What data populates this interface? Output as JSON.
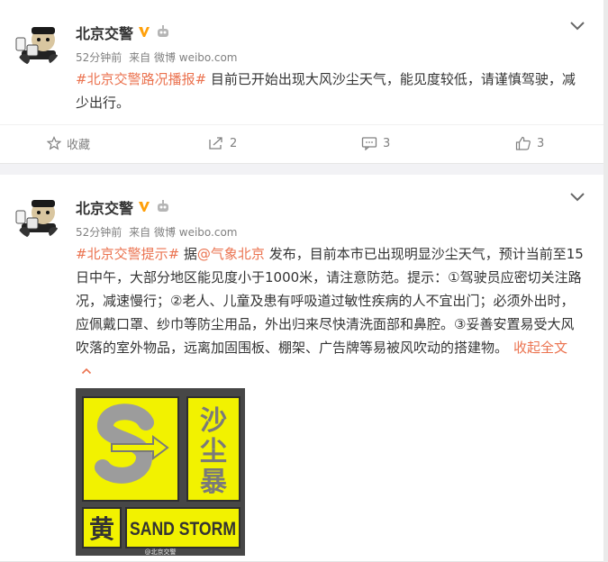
{
  "posts": [
    {
      "username": "北京交警",
      "time": "52分钟前",
      "from_label": "来自",
      "source": "微博 weibo.com",
      "hashtag": "#北京交警路况播报#",
      "body": " 目前已开始出现大风沙尘天气，能见度较低，请谨慎驾驶，减少出行。",
      "actions": {
        "favorite": "收藏",
        "repost": "2",
        "comment": "3",
        "like": "3"
      }
    },
    {
      "username": "北京交警",
      "time": "52分钟前",
      "from_label": "来自",
      "source": "微博 weibo.com",
      "hashtag": "#北京交警提示#",
      "pre_mention": " 据",
      "mention": "@气象北京",
      "body": " 发布，目前本市已出现明显沙尘天气，预计当前至15日中午，大部分地区能见度小于1000米，请注意防范。提示：①驾驶员应密切关注路况，减速慢行；②老人、儿童及患有呼吸道过敏性疾病的人不宜出门；必须外出时，应佩戴口罩、纱巾等防尘用品，外出归来尽快清洗面部和鼻腔。③妥善安置易受大风吹落的室外物品，远离加固围板、棚架、广告牌等易被风吹动的搭建物。",
      "fold_label": "收起全文",
      "image": {
        "title_chars": [
          "沙",
          "尘",
          "暴"
        ],
        "level_char": "黄",
        "label": "SAND STORM",
        "watermark": "@北京交警"
      }
    }
  ],
  "colors": {
    "accent": "#eb7350",
    "verify": "#ffa00a",
    "warning_yellow": "#f2f200"
  }
}
